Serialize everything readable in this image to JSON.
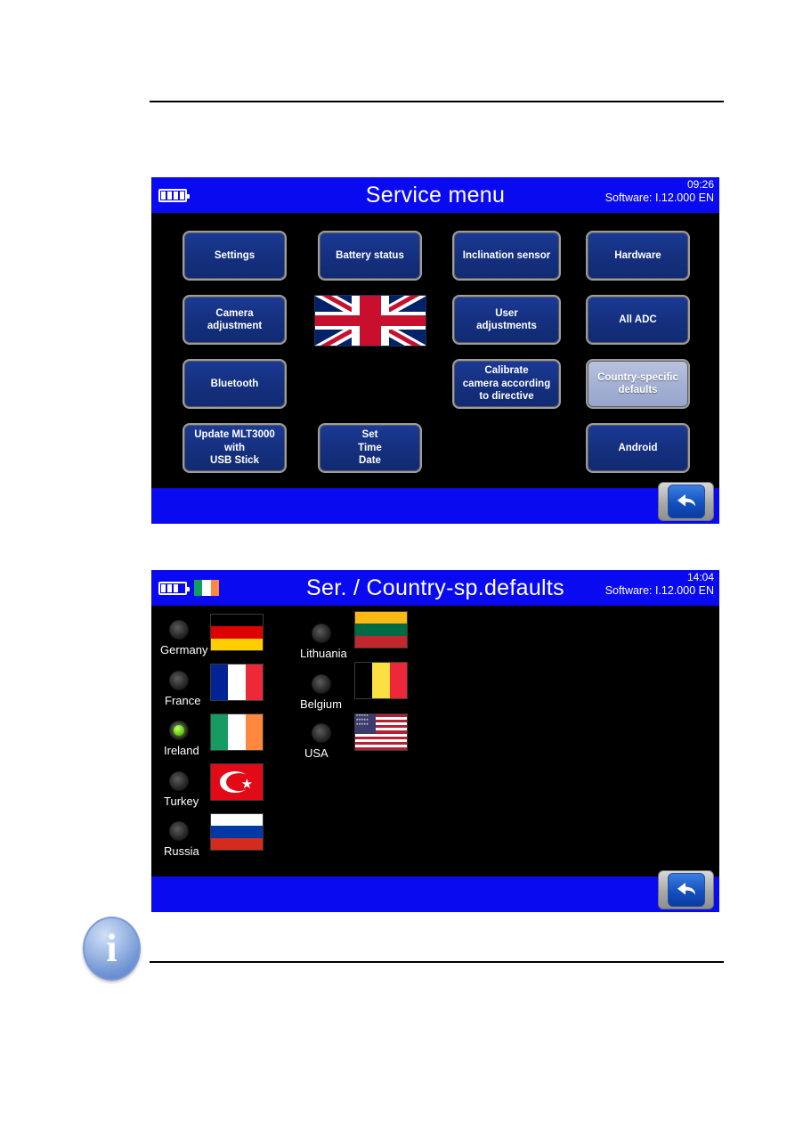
{
  "screens": [
    {
      "id": "service-menu",
      "titlebar": {
        "title": "Service menu",
        "time": "09:26",
        "software": "Software: I.12.000 EN",
        "battery_icon": "battery-icon",
        "battery_cells": 4
      },
      "buttons": [
        {
          "label": "Settings",
          "selected": false
        },
        {
          "label": "Battery status",
          "selected": false
        },
        {
          "label": "Inclination sensor",
          "selected": false
        },
        {
          "label": "Hardware",
          "selected": false
        },
        {
          "label": "Camera\nadjustment",
          "selected": false
        },
        {
          "label": "User\nadjustments",
          "selected": false
        },
        {
          "label": "All ADC",
          "selected": false
        },
        {
          "label": "Bluetooth",
          "selected": false
        },
        {
          "label": "Calibrate\ncamera according\nto directive",
          "selected": false
        },
        {
          "label": "Country-specific\ndefaults",
          "selected": true
        },
        {
          "label": "Update MLT3000\nwith\nUSB Stick",
          "selected": false
        },
        {
          "label": "Set\nTime\nDate",
          "selected": false
        },
        {
          "label": "Android",
          "selected": false
        }
      ],
      "language_flag": "united-kingdom-flag",
      "back_button": "back-icon"
    },
    {
      "id": "country-defaults",
      "titlebar": {
        "title": "Ser. / Country-sp.defaults",
        "time": "14:04",
        "software": "Software: I.12.000 EN",
        "battery_icon": "battery-icon",
        "battery_cells": 3,
        "header_flag": "ireland-flag"
      },
      "countries": [
        {
          "label": "Germany",
          "flag": "germany-flag",
          "selected": false
        },
        {
          "label": "France",
          "flag": "france-flag",
          "selected": false
        },
        {
          "label": "Ireland",
          "flag": "ireland-flag",
          "selected": true
        },
        {
          "label": "Turkey",
          "flag": "turkey-flag",
          "selected": false
        },
        {
          "label": "Russia",
          "flag": "russia-flag",
          "selected": false
        },
        {
          "label": "Lithuania",
          "flag": "lithuania-flag",
          "selected": false
        },
        {
          "label": "Belgium",
          "flag": "belgium-flag",
          "selected": false
        },
        {
          "label": "USA",
          "flag": "usa-flag",
          "selected": false
        }
      ],
      "back_button": "back-icon"
    }
  ],
  "note": {
    "icon": "info-icon",
    "glyph": "i"
  },
  "colors": {
    "titlebar_blue": "#0a0af0",
    "screen_black": "#000000",
    "button_blue": "#15307f",
    "button_border": "#9d9d9d",
    "button_selected": "#a5b1d4",
    "led_on_green": "#6fd41a"
  }
}
